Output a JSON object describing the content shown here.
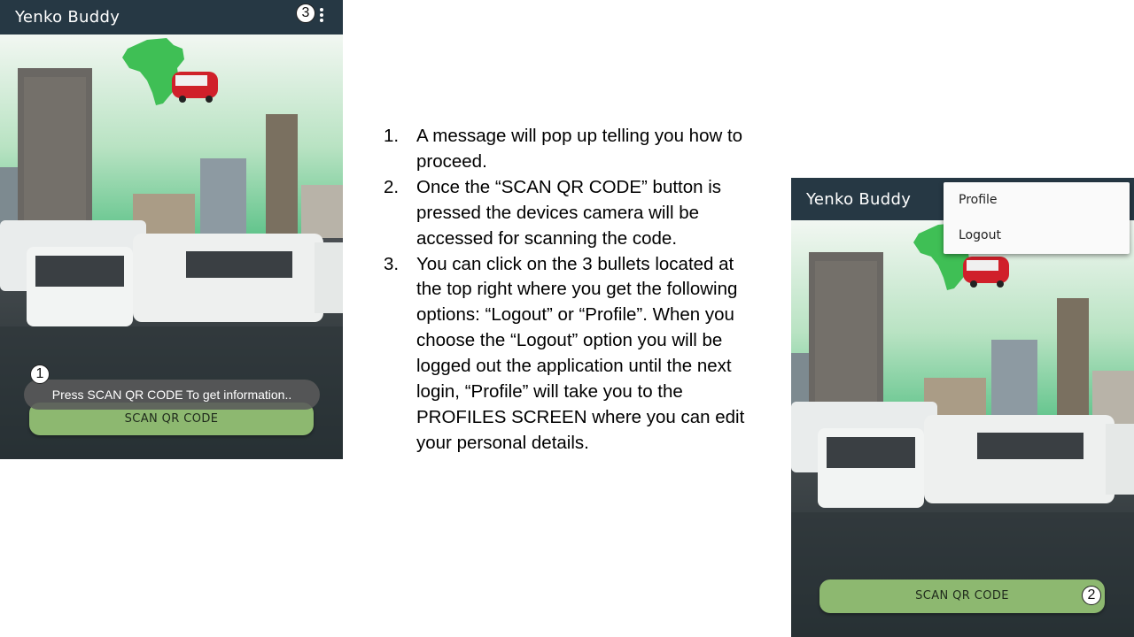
{
  "left_phone": {
    "app_title": "Yenko Buddy",
    "toast": "Press SCAN QR CODE To get information..",
    "scan_button": "SCAN QR CODE",
    "badges": [
      "1",
      "3"
    ]
  },
  "right_phone": {
    "app_title": "Yenko Buddy",
    "menu_items": [
      "Profile",
      "Logout"
    ],
    "scan_button": "SCAN QR CODE",
    "badge": "2"
  },
  "instructions": [
    {
      "num": "1.",
      "text": "A message will pop up telling you how to proceed."
    },
    {
      "num": "2.",
      "text": "Once the “SCAN QR CODE” button is pressed the devices camera will be accessed for scanning the code."
    },
    {
      "num": "3.",
      "text": "You can click on the 3 bullets located at the top right where you get the following options: “Logout” or “Profile”. When you choose the “Logout” option you will be logged out the application until the next login, “Profile” will take you to the PROFILES SCREEN where you can edit your personal details."
    }
  ],
  "colors": {
    "appbar": "#263844",
    "button": "#8db870",
    "africa_green": "#3fbf55",
    "taxi_red": "#d0202a"
  },
  "icons": [
    "overflow-menu-icon",
    "africa-logo-icon"
  ]
}
